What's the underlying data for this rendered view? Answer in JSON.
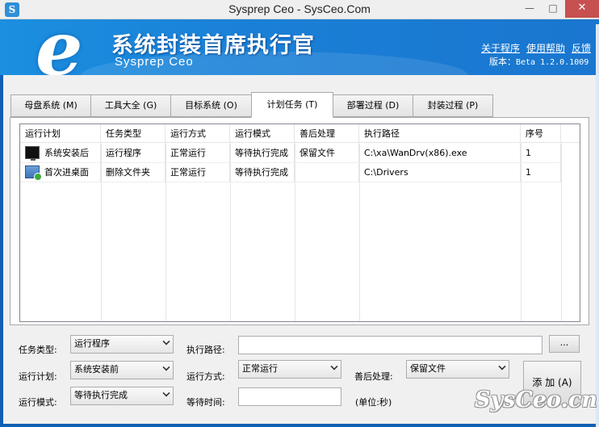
{
  "window": {
    "title": "Sysprep Ceo - SysCeo.Com",
    "icon": "app-logo-icon"
  },
  "banner": {
    "logo_letter": "e",
    "title": "系统封装首席执行官",
    "subtitle": "Sysprep Ceo",
    "links": {
      "about": "关于程序",
      "help": "使用帮助",
      "feedback": "反馈"
    },
    "version_label": "版本：",
    "version_value": "Beta 1.2.0.1009"
  },
  "tabs": [
    {
      "label": "母盘系统 (M)",
      "active": false
    },
    {
      "label": "工具大全 (G)",
      "active": false
    },
    {
      "label": "目标系统 (O)",
      "active": false
    },
    {
      "label": "计划任务 (T)",
      "active": true
    },
    {
      "label": "部署过程 (D)",
      "active": false
    },
    {
      "label": "封装过程 (P)",
      "active": false
    }
  ],
  "grid": {
    "columns": [
      "运行计划",
      "任务类型",
      "运行方式",
      "运行模式",
      "善后处理",
      "执行路径",
      "序号"
    ],
    "rows": [
      {
        "icon": "monitor-icon",
        "cells": [
          "系统安装后",
          "运行程序",
          "正常运行",
          "等待执行完成",
          "保留文件",
          "C:\\xa\\WanDrv(x86).exe",
          "1"
        ]
      },
      {
        "icon": "desktop-icon",
        "cells": [
          "首次进桌面",
          "删除文件夹",
          "正常运行",
          "等待执行完成",
          "",
          "C:\\Drivers",
          "1"
        ]
      }
    ]
  },
  "form": {
    "task_type_label": "任务类型:",
    "task_type_value": "运行程序",
    "exec_path_label": "执行路径:",
    "exec_path_value": "",
    "browse_label": "...",
    "run_plan_label": "运行计划:",
    "run_plan_value": "系统安装前",
    "run_method_label": "运行方式:",
    "run_method_value": "正常运行",
    "after_label": "善后处理:",
    "after_value": "保留文件",
    "run_mode_label": "运行模式:",
    "run_mode_value": "等待执行完成",
    "wait_time_label": "等待时间:",
    "wait_time_value": "",
    "unit_label": "(单位:秒)",
    "add_button": "添 加 (A)"
  },
  "watermark": "SysCeo.cn",
  "colors": {
    "banner_blue": "#1a7fd6",
    "frame_blue": "#0f5fb4",
    "close_red": "#c75050"
  }
}
